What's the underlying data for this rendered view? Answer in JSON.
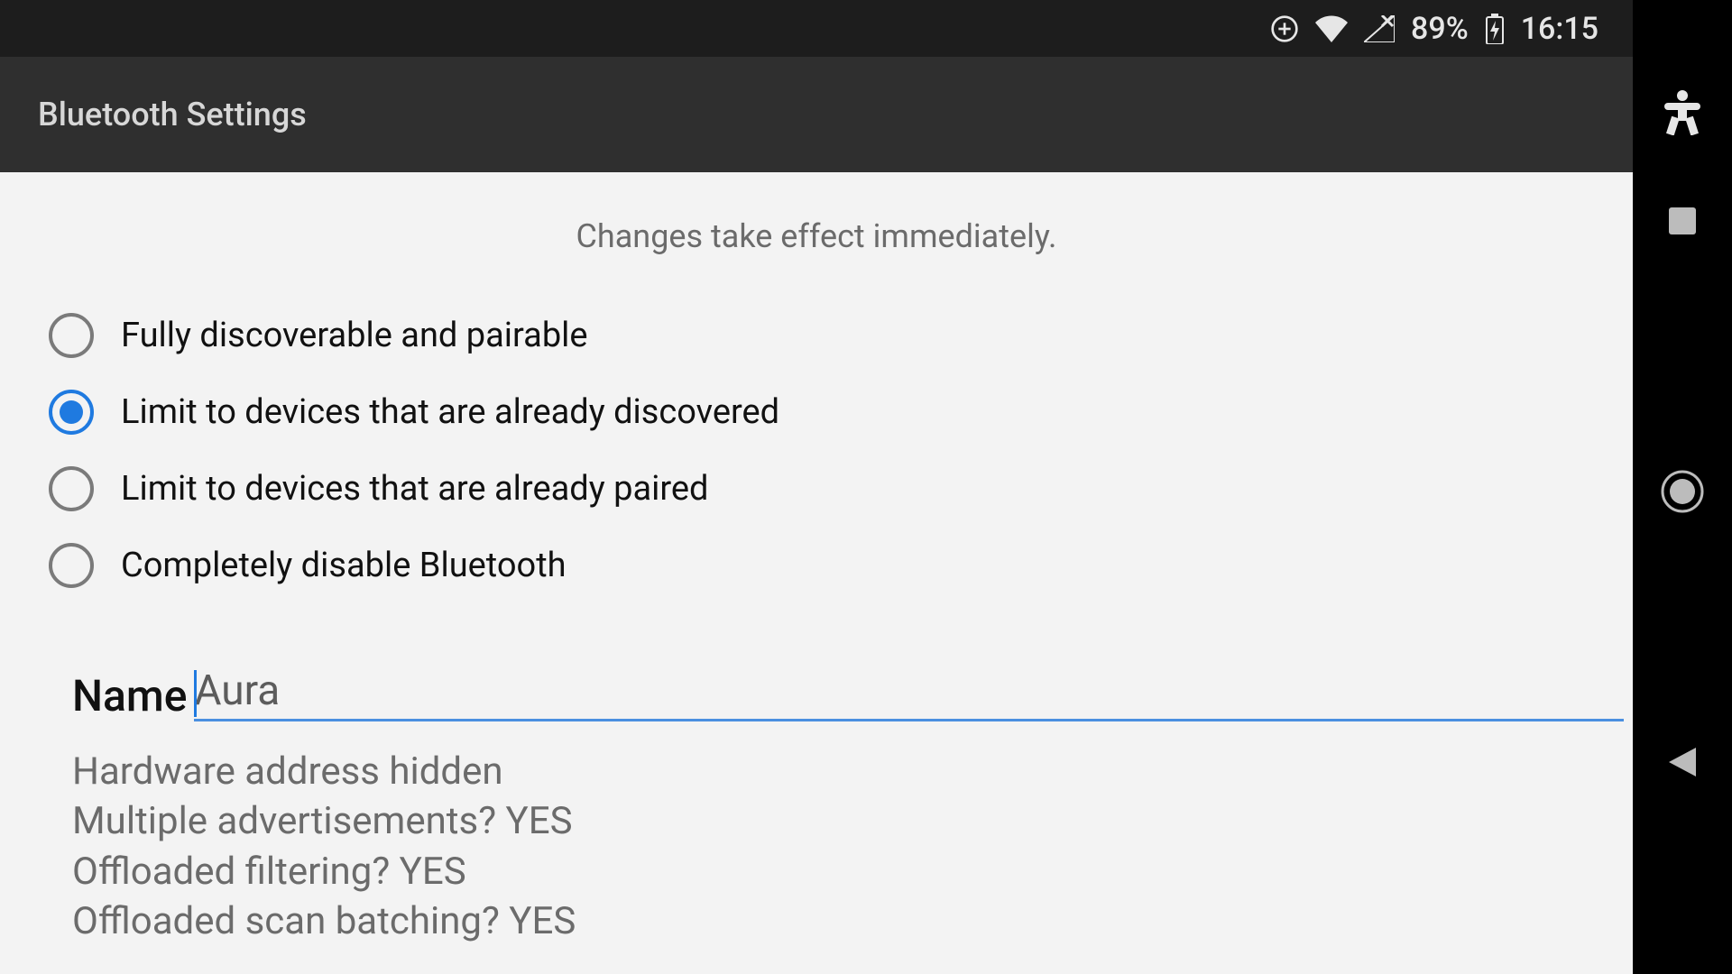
{
  "statusbar": {
    "battery_pct": "89%",
    "clock": "16:15"
  },
  "appbar": {
    "title": "Bluetooth Settings"
  },
  "notice": "Changes take effect immediately.",
  "radio": {
    "opt0": "Fully discoverable and pairable",
    "opt1": "Limit to devices that are already discovered",
    "opt2": "Limit to devices that are already paired",
    "opt3": "Completely disable Bluetooth",
    "selected_index": 1
  },
  "name": {
    "label": "Name",
    "value": "Aura"
  },
  "info": {
    "l0": "Hardware address hidden",
    "l1": "Multiple advertisements? YES",
    "l2": "Offloaded filtering? YES",
    "l3": "Offloaded scan batching? YES"
  }
}
